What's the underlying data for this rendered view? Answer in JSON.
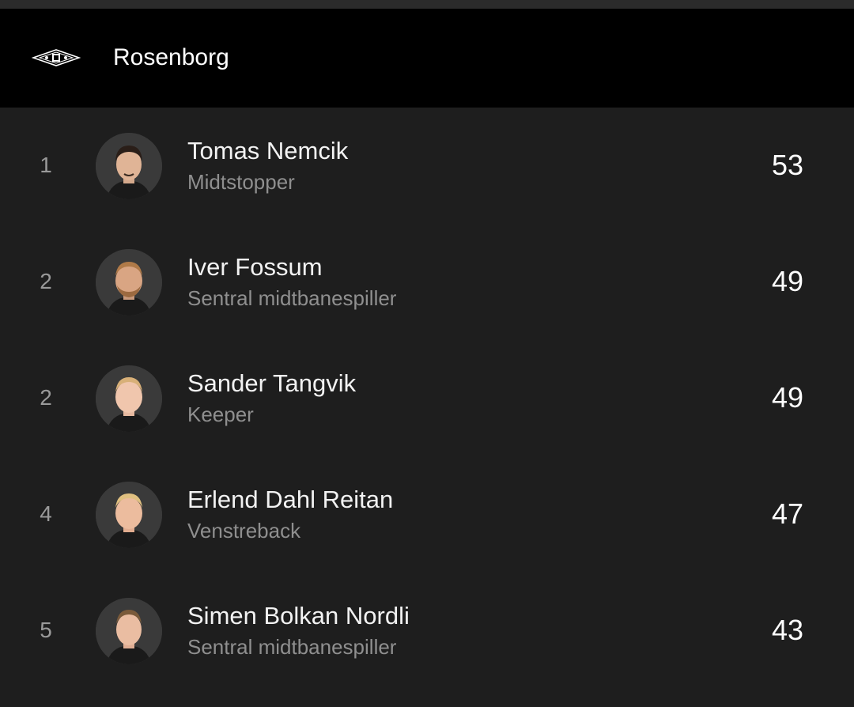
{
  "header": {
    "team_name": "Rosenborg",
    "logo_icon": "rosenborg-crest-icon"
  },
  "colors": {
    "background": "#1e1e1e",
    "header_background": "#000000",
    "primary_text": "#ffffff",
    "secondary_text": "#8f8f8f"
  },
  "players": [
    {
      "rank": "1",
      "name": "Tomas Nemcik",
      "position": "Midtstopper",
      "score": "53",
      "avatar_icon": "player-avatar"
    },
    {
      "rank": "2",
      "name": "Iver Fossum",
      "position": "Sentral midtbanespiller",
      "score": "49",
      "avatar_icon": "player-avatar"
    },
    {
      "rank": "2",
      "name": "Sander Tangvik",
      "position": "Keeper",
      "score": "49",
      "avatar_icon": "player-avatar"
    },
    {
      "rank": "4",
      "name": "Erlend Dahl Reitan",
      "position": "Venstreback",
      "score": "47",
      "avatar_icon": "player-avatar"
    },
    {
      "rank": "5",
      "name": "Simen Bolkan Nordli",
      "position": "Sentral midtbanespiller",
      "score": "43",
      "avatar_icon": "player-avatar"
    }
  ]
}
